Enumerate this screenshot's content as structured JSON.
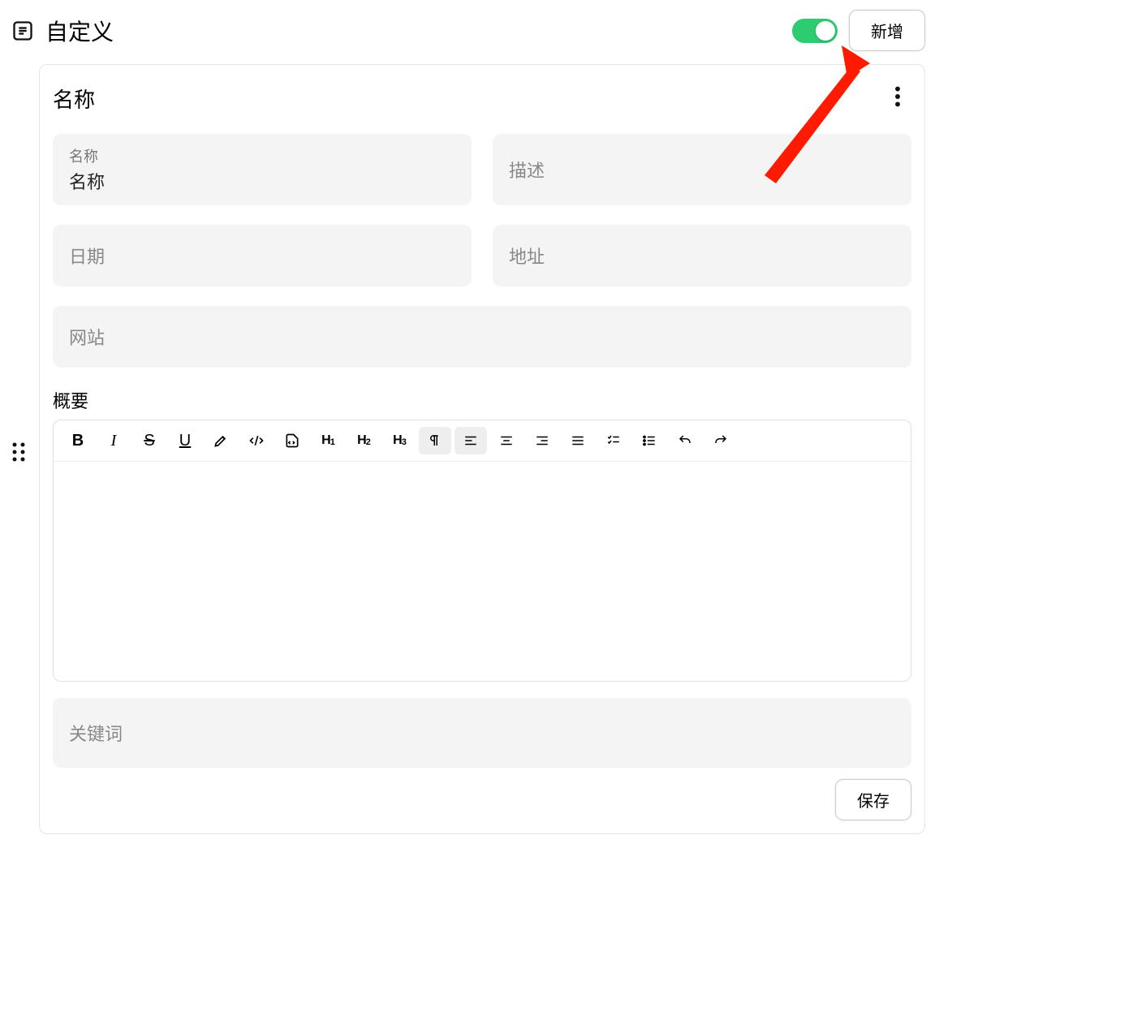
{
  "header": {
    "title": "自定义",
    "toggle_on": true,
    "add_label": "新增"
  },
  "card": {
    "title": "名称",
    "fields": {
      "name_label": "名称",
      "name_value": "名称",
      "description_placeholder": "描述",
      "date_placeholder": "日期",
      "address_placeholder": "地址",
      "website_placeholder": "网站"
    },
    "summary_label": "概要",
    "keywords_placeholder": "关键词",
    "save_label": "保存"
  },
  "toolbar": {
    "bold": "B",
    "italic": "I",
    "strike": "S",
    "underline": "U",
    "highlight": "highlight",
    "code": "</>",
    "codeblock": "codeblock",
    "h1": "H1",
    "h2": "H2",
    "h3": "H3",
    "paragraph": "¶",
    "align_left": "left",
    "align_center": "center",
    "align_right": "right",
    "align_justify": "justify",
    "list_bullet": "bullet",
    "list_number": "numbered",
    "undo": "undo",
    "redo": "redo"
  },
  "annotation": {
    "arrow_color": "#ff1a00",
    "arrow_target": "add-button"
  }
}
